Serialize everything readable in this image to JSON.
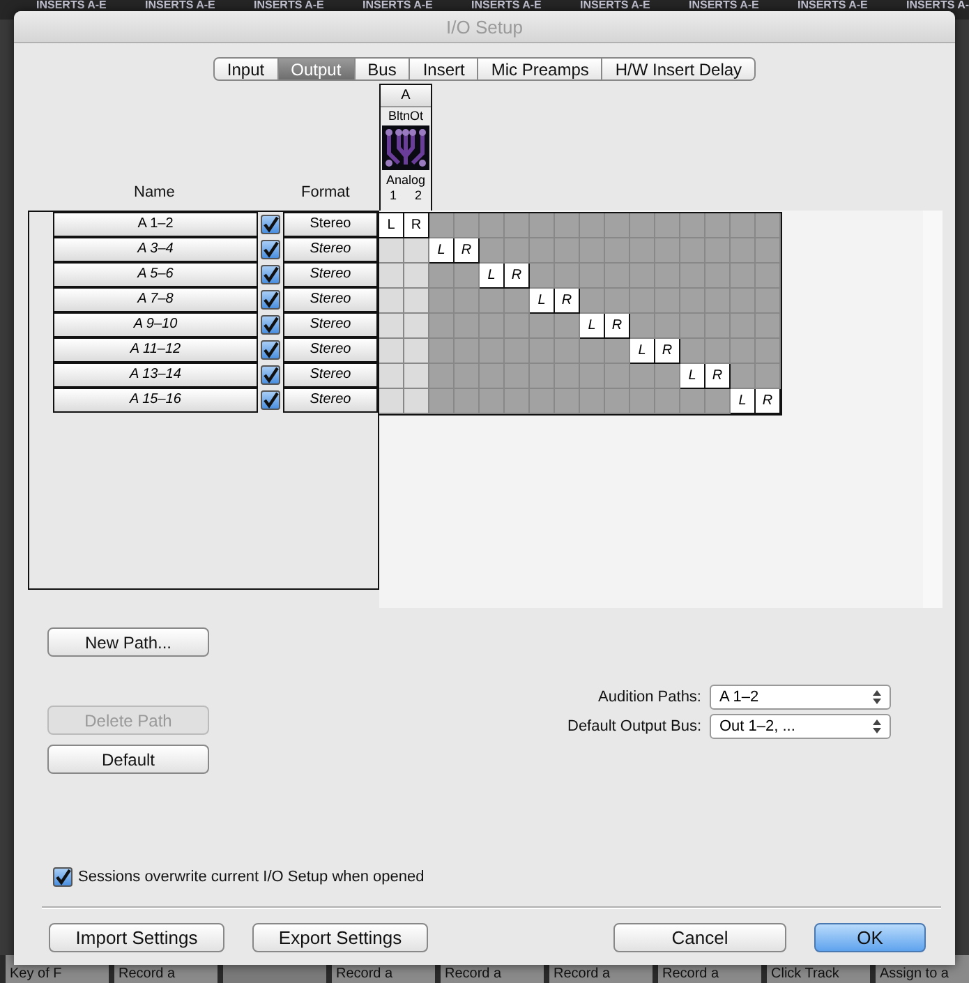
{
  "background": {
    "headers": [
      "INSERTS A-E",
      "INSERTS A-E",
      "INSERTS A-E",
      "INSERTS A-E",
      "INSERTS A-E",
      "INSERTS A-E",
      "INSERTS A-E",
      "INSERTS A-E",
      "INSERTS A-"
    ],
    "clips": [
      {
        "kind": "clip",
        "label": "Key of F"
      },
      {
        "kind": "clip",
        "label": "Record a"
      },
      {
        "kind": "blank"
      },
      {
        "kind": "clip",
        "label": "Record a"
      },
      {
        "kind": "clip",
        "label": "Record a"
      },
      {
        "kind": "clip",
        "label": "Record a"
      },
      {
        "kind": "clip",
        "label": "Record a"
      },
      {
        "kind": "clip",
        "label": "Click Track"
      },
      {
        "kind": "clip",
        "label": "Assign to a"
      }
    ]
  },
  "window": {
    "title": "I/O Setup"
  },
  "tabs": [
    {
      "label": "Input",
      "selected": false
    },
    {
      "label": "Output",
      "selected": true
    },
    {
      "label": "Bus",
      "selected": false
    },
    {
      "label": "Insert",
      "selected": false
    },
    {
      "label": "Mic Preamps",
      "selected": false
    },
    {
      "label": "H/W Insert Delay",
      "selected": false
    }
  ],
  "table": {
    "name_header": "Name",
    "format_header": "Format",
    "device": {
      "group": "A",
      "name": "BltnOt",
      "type": "Analog"
    },
    "columns": [
      {
        "label": "1",
        "shaded": false
      },
      {
        "label": "2",
        "shaded": false
      },
      {
        "shaded": true
      },
      {
        "shaded": true
      },
      {
        "shaded": true
      },
      {
        "shaded": true
      },
      {
        "shaded": true
      },
      {
        "shaded": true
      },
      {
        "shaded": true
      },
      {
        "shaded": true
      },
      {
        "shaded": true
      },
      {
        "shaded": true
      },
      {
        "shaded": true
      },
      {
        "shaded": true
      },
      {
        "shaded": true
      },
      {
        "shaded": true
      }
    ],
    "rows": [
      {
        "name": "A 1–2",
        "checked": true,
        "format": "Stereo",
        "inactive": false,
        "cells": [
          {
            "label": "L"
          },
          {
            "label": "R"
          },
          {},
          {},
          {},
          {},
          {},
          {},
          {},
          {},
          {},
          {},
          {},
          {},
          {},
          {}
        ]
      },
      {
        "name": "A 3–4",
        "checked": true,
        "format": "Stereo",
        "inactive": true,
        "cells": [
          {},
          {},
          {
            "label": "L"
          },
          {
            "label": "R"
          },
          {},
          {},
          {},
          {},
          {},
          {},
          {},
          {},
          {},
          {},
          {},
          {}
        ]
      },
      {
        "name": "A 5–6",
        "checked": true,
        "format": "Stereo",
        "inactive": true,
        "cells": [
          {},
          {},
          {},
          {},
          {
            "label": "L"
          },
          {
            "label": "R"
          },
          {},
          {},
          {},
          {},
          {},
          {},
          {},
          {},
          {},
          {}
        ]
      },
      {
        "name": "A 7–8",
        "checked": true,
        "format": "Stereo",
        "inactive": true,
        "cells": [
          {},
          {},
          {},
          {},
          {},
          {},
          {
            "label": "L"
          },
          {
            "label": "R"
          },
          {},
          {},
          {},
          {},
          {},
          {},
          {},
          {}
        ]
      },
      {
        "name": "A 9–10",
        "checked": true,
        "format": "Stereo",
        "inactive": true,
        "cells": [
          {},
          {},
          {},
          {},
          {},
          {},
          {},
          {},
          {
            "label": "L"
          },
          {
            "label": "R"
          },
          {},
          {},
          {},
          {},
          {},
          {}
        ]
      },
      {
        "name": "A 11–12",
        "checked": true,
        "format": "Stereo",
        "inactive": true,
        "cells": [
          {},
          {},
          {},
          {},
          {},
          {},
          {},
          {},
          {},
          {},
          {
            "label": "L"
          },
          {
            "label": "R"
          },
          {},
          {},
          {},
          {}
        ]
      },
      {
        "name": "A 13–14",
        "checked": true,
        "format": "Stereo",
        "inactive": true,
        "cells": [
          {},
          {},
          {},
          {},
          {},
          {},
          {},
          {},
          {},
          {},
          {},
          {},
          {
            "label": "L"
          },
          {
            "label": "R"
          },
          {},
          {}
        ]
      },
      {
        "name": "A 15–16",
        "checked": true,
        "format": "Stereo",
        "inactive": true,
        "cells": [
          {},
          {},
          {},
          {},
          {},
          {},
          {},
          {},
          {},
          {},
          {},
          {},
          {},
          {},
          {
            "label": "L"
          },
          {
            "label": "R"
          }
        ]
      }
    ]
  },
  "path_buttons": [
    {
      "label": "New Path...",
      "disabled": false
    },
    {
      "label": "Delete Path",
      "disabled": true
    },
    {
      "label": "Default",
      "disabled": false
    }
  ],
  "selects": [
    {
      "label": "Audition Paths:",
      "value": "A 1–2"
    },
    {
      "label": "Default Output Bus:",
      "value": "Out 1–2, ..."
    }
  ],
  "overwrite": {
    "label": "Sessions overwrite current I/O Setup when opened",
    "checked": true
  },
  "footer_left": [
    {
      "label": "Import Settings",
      "primary": false
    },
    {
      "label": "Export Settings",
      "primary": false
    }
  ],
  "footer_right": [
    {
      "label": "Cancel",
      "primary": false
    },
    {
      "label": "OK",
      "primary": true
    }
  ]
}
